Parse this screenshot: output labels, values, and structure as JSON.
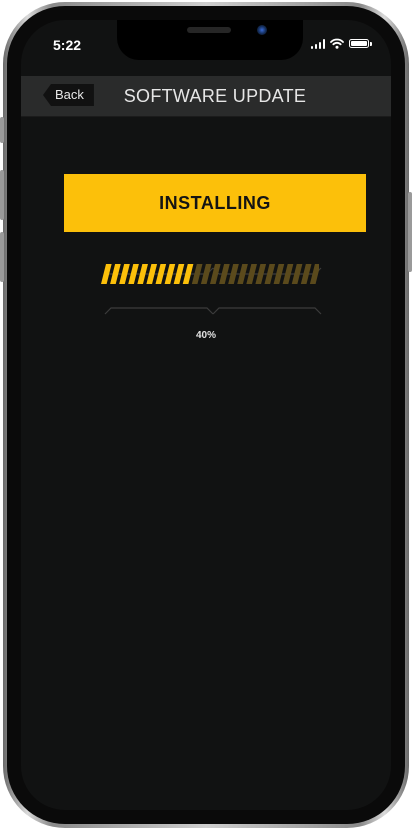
{
  "status_bar": {
    "time": "5:22"
  },
  "header": {
    "back_label": "Back",
    "title": "SOFTWARE UPDATE"
  },
  "update": {
    "status_label": "INSTALLING",
    "progress_fraction": 0.4,
    "progress_text": "40%"
  },
  "colors": {
    "accent": "#fcc00a",
    "progress_track": "#5b4a1c",
    "screen_background": "#111212",
    "header_background": "#2a2b2b"
  },
  "icons": {
    "signal": "cellular-signal-icon",
    "wifi": "wifi-icon",
    "battery": "battery-icon"
  }
}
